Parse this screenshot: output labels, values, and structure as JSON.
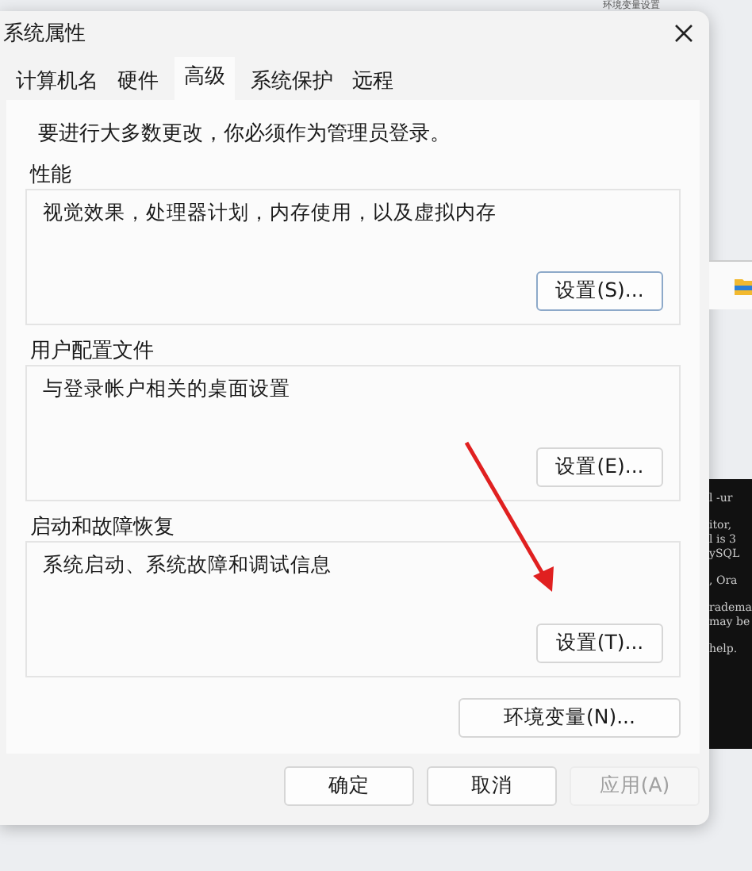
{
  "window": {
    "title": "系统属性"
  },
  "tabs": [
    {
      "label": "计算机名",
      "selected": false
    },
    {
      "label": "硬件",
      "selected": false
    },
    {
      "label": "高级",
      "selected": true
    },
    {
      "label": "系统保护",
      "selected": false
    },
    {
      "label": "远程",
      "selected": false
    }
  ],
  "notice": "要进行大多数更改，你必须作为管理员登录。",
  "groups": [
    {
      "title": "性能",
      "description": "视觉效果，处理器计划，内存使用，以及虚拟内存",
      "button": {
        "label": "设置(S)...",
        "focused": true
      }
    },
    {
      "title": "用户配置文件",
      "description": "与登录帐户相关的桌面设置",
      "button": {
        "label": "设置(E)...",
        "focused": false
      }
    },
    {
      "title": "启动和故障恢复",
      "description": "系统启动、系统故障和调试信息",
      "button": {
        "label": "设置(T)...",
        "focused": false
      }
    }
  ],
  "env_button": {
    "label": "环境变量(N)..."
  },
  "footer_buttons": [
    {
      "label": "确定",
      "disabled": false
    },
    {
      "label": "取消",
      "disabled": false
    },
    {
      "label": "应用(A)",
      "disabled": true
    }
  ],
  "background": {
    "label": "环境变量设置",
    "terminal_blocks": [
      [
        "l -ur"
      ],
      [
        "itor,",
        "l is 3",
        "ySQL"
      ],
      [
        ", Ora"
      ],
      [
        "radema",
        "may be"
      ],
      [
        "help."
      ]
    ]
  }
}
